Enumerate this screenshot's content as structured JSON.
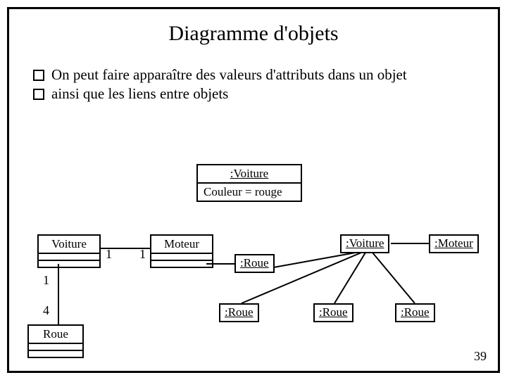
{
  "title": "Diagramme d'objets",
  "bullets": {
    "b1": "On peut faire apparaître des valeurs d'attributs dans un objet",
    "b2": "ainsi que les liens entre objets"
  },
  "voiture_obj": {
    "name": ":Voiture",
    "attr": "Couleur = rouge"
  },
  "class_voiture": "Voiture",
  "class_moteur": "Moteur",
  "class_roue": "Roue",
  "mult": {
    "one_a": "1",
    "one_b": "1",
    "one_c": "1",
    "four": "4"
  },
  "inst": {
    "roue1": ":Roue",
    "roue2": ":Roue",
    "roue3": ":Roue",
    "roue4": ":Roue",
    "voiture2": ":Voiture",
    "moteur2": ":Moteur"
  },
  "page": "39"
}
